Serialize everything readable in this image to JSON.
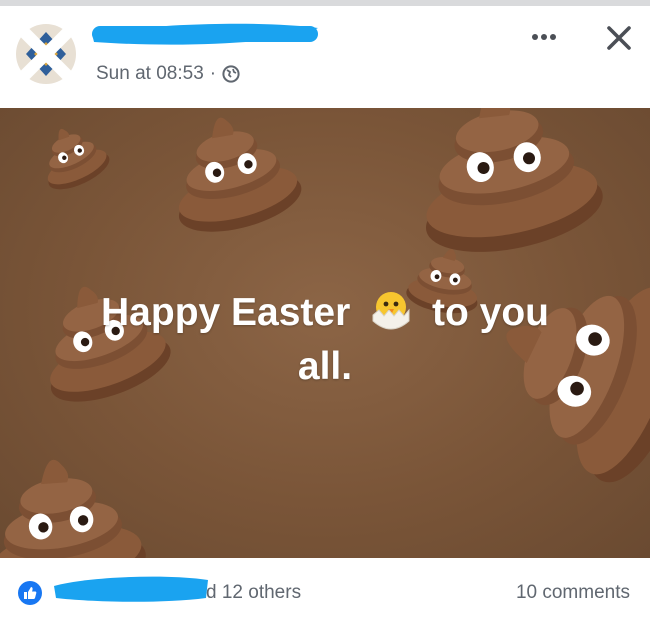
{
  "post": {
    "timestamp": "Sun at 08:53",
    "separator": "·",
    "privacy_icon": "globe-icon",
    "text_line1_a": "Happy Easter",
    "text_emoji": "hatching-chick-icon",
    "text_line1_b": "to you",
    "text_line2": "all."
  },
  "header": {
    "more_icon": "more-options-icon",
    "close_icon": "close-icon"
  },
  "footer": {
    "reaction_icon": "like-icon",
    "reactions_text": "d 12 others",
    "comments_text": "10 comments"
  },
  "colors": {
    "background": "#7a5538",
    "redaction": "#1aa3f0",
    "like_blue": "#1877f2",
    "meta_text": "#606770"
  }
}
